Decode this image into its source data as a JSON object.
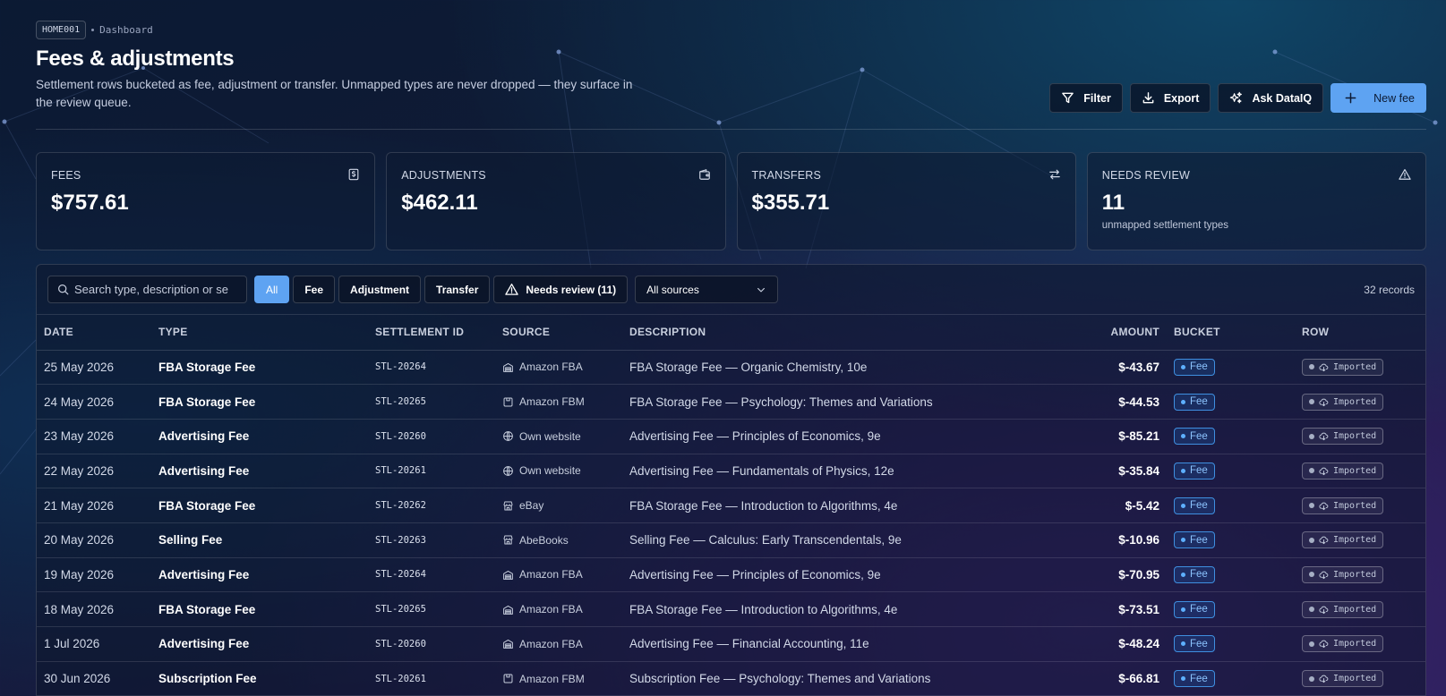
{
  "breadcrumb": {
    "code": "HOME001",
    "page": "Dashboard"
  },
  "header": {
    "title": "Fees & adjustments",
    "subtitle": "Settlement rows bucketed as fee, adjustment or transfer. Unmapped types are never dropped — they surface in the review queue."
  },
  "actions": {
    "filter": "Filter",
    "export": "Export",
    "ask": "Ask DataIQ",
    "new_fee": "New fee"
  },
  "cards": [
    {
      "label": "FEES",
      "value": "$757.61",
      "icon": "dollar-receipt-icon"
    },
    {
      "label": "ADJUSTMENTS",
      "value": "$462.11",
      "icon": "wallet-icon"
    },
    {
      "label": "TRANSFERS",
      "value": "$355.71",
      "icon": "arrows-swap-icon"
    },
    {
      "label": "NEEDS REVIEW",
      "value": "11",
      "sub": "unmapped settlement types",
      "icon": "warning-triangle-icon"
    }
  ],
  "toolbar": {
    "search_placeholder": "Search type, description or se",
    "chips": {
      "all": "All",
      "fee": "Fee",
      "adjustment": "Adjustment",
      "transfer": "Transfer",
      "review": "Needs review (11)"
    },
    "source_select": "All sources",
    "records": "32 records"
  },
  "table": {
    "columns": {
      "date": "DATE",
      "type": "TYPE",
      "sid": "SETTLEMENT ID",
      "source": "SOURCE",
      "desc": "DESCRIPTION",
      "amount": "AMOUNT",
      "bucket": "BUCKET",
      "row": "ROW"
    },
    "rows": [
      {
        "date": "25 May 2026",
        "type": "FBA Storage Fee",
        "sid": "STL-20264",
        "source": "Amazon FBA",
        "source_icon": "warehouse-icon",
        "desc": "FBA Storage Fee — Organic Chemistry, 10e",
        "amount": "$-43.67",
        "bucket": "Fee",
        "row": "Imported"
      },
      {
        "date": "24 May 2026",
        "type": "FBA Storage Fee",
        "sid": "STL-20265",
        "source": "Amazon FBM",
        "source_icon": "package-icon",
        "desc": "FBA Storage Fee — Psychology: Themes and Variations",
        "amount": "$-44.53",
        "bucket": "Fee",
        "row": "Imported"
      },
      {
        "date": "23 May 2026",
        "type": "Advertising Fee",
        "sid": "STL-20260",
        "source": "Own website",
        "source_icon": "globe-icon",
        "desc": "Advertising Fee — Principles of Economics, 9e",
        "amount": "$-85.21",
        "bucket": "Fee",
        "row": "Imported"
      },
      {
        "date": "22 May 2026",
        "type": "Advertising Fee",
        "sid": "STL-20261",
        "source": "Own website",
        "source_icon": "globe-icon",
        "desc": "Advertising Fee — Fundamentals of Physics, 12e",
        "amount": "$-35.84",
        "bucket": "Fee",
        "row": "Imported"
      },
      {
        "date": "21 May 2026",
        "type": "FBA Storage Fee",
        "sid": "STL-20262",
        "source": "eBay",
        "source_icon": "store-icon",
        "desc": "FBA Storage Fee — Introduction to Algorithms, 4e",
        "amount": "$-5.42",
        "bucket": "Fee",
        "row": "Imported"
      },
      {
        "date": "20 May 2026",
        "type": "Selling Fee",
        "sid": "STL-20263",
        "source": "AbeBooks",
        "source_icon": "store-icon",
        "desc": "Selling Fee — Calculus: Early Transcendentals, 9e",
        "amount": "$-10.96",
        "bucket": "Fee",
        "row": "Imported"
      },
      {
        "date": "19 May 2026",
        "type": "Advertising Fee",
        "sid": "STL-20264",
        "source": "Amazon FBA",
        "source_icon": "warehouse-icon",
        "desc": "Advertising Fee — Principles of Economics, 9e",
        "amount": "$-70.95",
        "bucket": "Fee",
        "row": "Imported"
      },
      {
        "date": "18 May 2026",
        "type": "FBA Storage Fee",
        "sid": "STL-20265",
        "source": "Amazon FBA",
        "source_icon": "warehouse-icon",
        "desc": "FBA Storage Fee — Introduction to Algorithms, 4e",
        "amount": "$-73.51",
        "bucket": "Fee",
        "row": "Imported"
      },
      {
        "date": "1 Jul 2026",
        "type": "Advertising Fee",
        "sid": "STL-20260",
        "source": "Amazon FBA",
        "source_icon": "warehouse-icon",
        "desc": "Advertising Fee — Financial Accounting, 11e",
        "amount": "$-48.24",
        "bucket": "Fee",
        "row": "Imported"
      },
      {
        "date": "30 Jun 2026",
        "type": "Subscription Fee",
        "sid": "STL-20261",
        "source": "Amazon FBM",
        "source_icon": "package-icon",
        "desc": "Subscription Fee — Psychology: Themes and Variations",
        "amount": "$-66.81",
        "bucket": "Fee",
        "row": "Imported"
      }
    ]
  },
  "colors": {
    "accent": "#5ea3f2",
    "fee_badge": "#3f8fe0"
  }
}
